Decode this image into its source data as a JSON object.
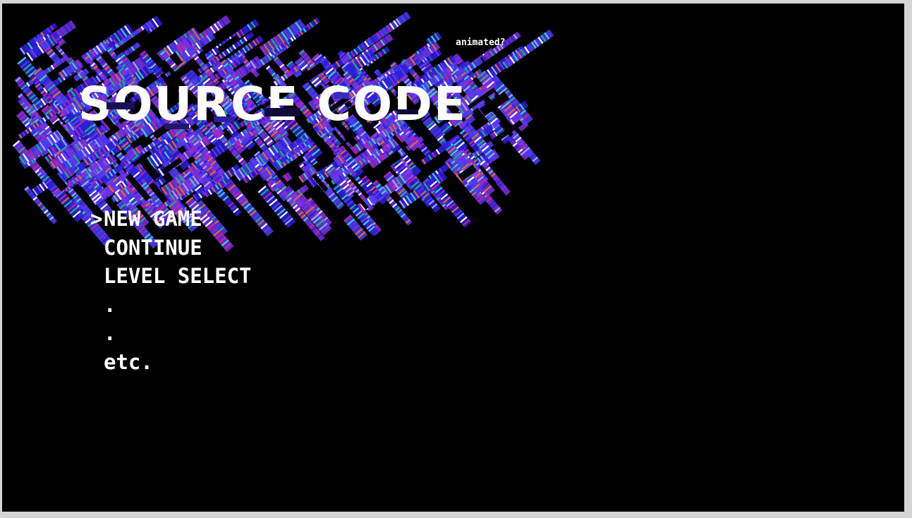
{
  "title": "SOURCE CODE",
  "animated_note": "animated?",
  "cursor_glyph": ">",
  "menu": {
    "selected_index": 0,
    "items": [
      {
        "label": "NEW GAME"
      },
      {
        "label": "CONTINUE"
      },
      {
        "label": "LEVEL SELECT"
      },
      {
        "label": "."
      },
      {
        "label": "."
      },
      {
        "label": "etc."
      }
    ]
  },
  "colors": {
    "background": "#000000",
    "text": "#ffffff",
    "window_frame": "#d4d4d4",
    "glitch_palette": [
      "#2a1fd6",
      "#4b3cf0",
      "#7a2fe0",
      "#c8209a",
      "#1fae8a",
      "#3fd1c7",
      "#e06a3a",
      "#9aa7ff",
      "#ffffff"
    ]
  }
}
